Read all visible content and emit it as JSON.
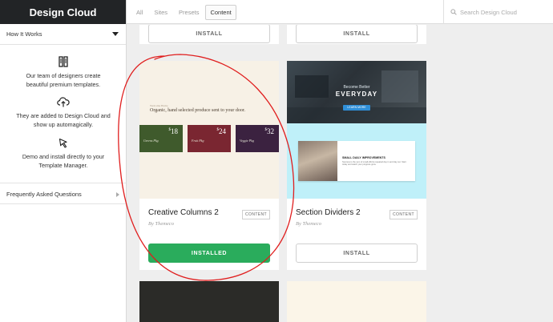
{
  "sidebar": {
    "brand": "Design Cloud",
    "how_it_works": {
      "label": "How It Works",
      "steps": [
        {
          "icon": "columns-icon",
          "text": "Our team of designers create beautiful premium templates."
        },
        {
          "icon": "cloud-upload-icon",
          "text": "They are added to Design Cloud and show up automagically."
        },
        {
          "icon": "cursor-arrow-icon",
          "text": "Demo and install directly to your Template Manager."
        }
      ]
    },
    "faq_label": "Frequently Asked Questions"
  },
  "topbar": {
    "tabs": [
      {
        "label": "All",
        "active": false
      },
      {
        "label": "Sites",
        "active": false
      },
      {
        "label": "Presets",
        "active": false
      },
      {
        "label": "Content",
        "active": true
      }
    ],
    "search_placeholder": "Search Design Cloud"
  },
  "cards": [
    {
      "title": "Creative Columns 2",
      "badge": "CONTENT",
      "author": "By Themeco",
      "button": "INSTALLED",
      "status": "installed",
      "preview": {
        "kicker": "Welcome Home",
        "heading": "Organic, hand selected produce sent to your door.",
        "items": [
          {
            "name": "Greens Pkg",
            "price": "18",
            "color": "#3f5a2c"
          },
          {
            "name": "Fruit Pkg",
            "price": "24",
            "color": "#7a2631"
          },
          {
            "name": "Veggie Pkg",
            "price": "32",
            "color": "#3b2240"
          }
        ],
        "currency": "$"
      }
    },
    {
      "title": "Section Dividers 2",
      "badge": "CONTENT",
      "author": "By Themeco",
      "button": "INSTALL",
      "status": "available",
      "preview": {
        "kicker": "Become Better",
        "headline": "EVERYDAY",
        "cta": "LEARN MORE",
        "panel_title": "SMALL DAILY IMPROVEMENTS",
        "panel_text": "Success is the sum of small efforts repeated day in and day out. Start today and watch your progress grow."
      }
    }
  ],
  "top_row_buttons": [
    "INSTALL",
    "INSTALL"
  ],
  "colors": {
    "installed_green": "#2aac5c",
    "annotation_red": "#e01e1e",
    "divider_cyan": "#bff0f9"
  }
}
